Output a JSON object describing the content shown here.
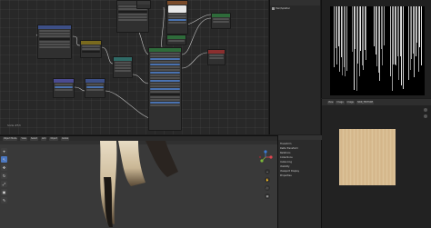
{
  "node_editor": {
    "status_label": "Slide #53",
    "nodes": [
      {
        "id": "n1",
        "color": "#3a3a3a"
      },
      {
        "id": "n2",
        "color": "#3a3a3a"
      },
      {
        "id": "n3",
        "color": "#3a3a3a"
      },
      {
        "id": "n4",
        "color": "#3a3a3a"
      },
      {
        "id": "n5",
        "color": "#3a3a3a"
      },
      {
        "id": "n6",
        "color": "#7a6a1e"
      },
      {
        "id": "n7",
        "color": "#2f6a66"
      },
      {
        "id": "n8",
        "color": "#3d4f86"
      },
      {
        "id": "n9",
        "color": "#3d4f86"
      },
      {
        "id": "n10",
        "color": "#2e6b3a"
      },
      {
        "id": "n11",
        "color": "#2e6b3a"
      },
      {
        "id": "n12",
        "color": "#2e6b3a"
      },
      {
        "id": "n13",
        "color": "#8a2f2f"
      }
    ]
  },
  "outliner": {
    "item_label": "Hair/Splatter"
  },
  "image_editor_top": {},
  "image_editor_bottom": {
    "header_buttons": [
      "View",
      "Image",
      "Image",
      "HAIR_TEXTURE"
    ],
    "side_icons": [
      "+",
      "+",
      "+"
    ]
  },
  "viewport": {
    "header_items": [
      "Object Mode",
      "View",
      "Select",
      "Add",
      "Object",
      "Global"
    ],
    "mode_label": "Object Mode",
    "tools": [
      "⌖",
      "↖",
      "✥",
      "↻",
      "⤢",
      "▣",
      "✎",
      "📏"
    ],
    "nav_buttons": [
      "+",
      "✋",
      "🎥",
      "▦"
    ]
  },
  "properties": {
    "rows": [
      "Transform",
      "Delta Transform",
      "Relations",
      "Collections",
      "Instancing",
      "Visibility",
      "Viewport Display",
      "Properties"
    ]
  },
  "colors": {
    "accent": "#4b77c0",
    "gizmo_x": "#e0454f",
    "gizmo_y": "#7db83a",
    "gizmo_z": "#3b7cd6"
  }
}
